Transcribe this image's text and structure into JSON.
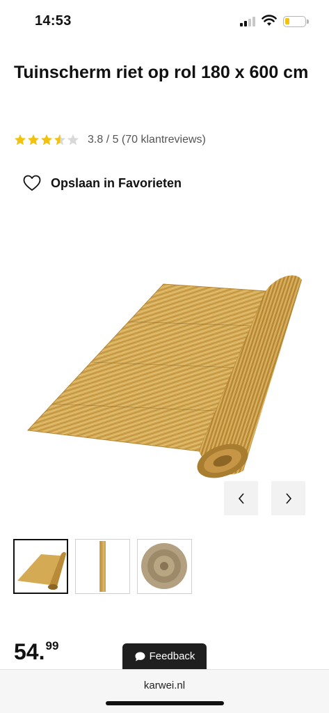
{
  "status_bar": {
    "time": "14:53"
  },
  "product": {
    "title": "Tuinscherm riet op rol 180 x 600 cm",
    "rating": {
      "value": 3.8,
      "max": 5,
      "text": "3.8 / 5 (70 klantreviews)",
      "star_color": "#f2c20c",
      "empty_star_color": "#d9d9d9"
    },
    "favorite_label": "Opslaan in Favorieten",
    "price": {
      "main": "54.",
      "cents": "99"
    }
  },
  "gallery": {
    "prev_icon": "chevron-left-icon",
    "next_icon": "chevron-right-icon",
    "thumbnail_count": 3,
    "active_thumbnail": 1
  },
  "feedback": {
    "label": "Feedback"
  },
  "browser": {
    "url": "karwei.nl"
  },
  "colors": {
    "reed_light": "#d9b25a",
    "reed_dark": "#a87a2c",
    "nav_button_bg": "#f2f2f2"
  }
}
